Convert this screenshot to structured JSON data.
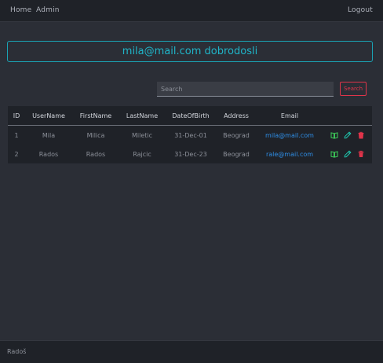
{
  "nav": {
    "home": "Home",
    "admin": "Admin",
    "logout": "Logout"
  },
  "welcome": "mila@mail.com dobrodosli",
  "search": {
    "placeholder": "Search",
    "button": "Search"
  },
  "table": {
    "headers": [
      "ID",
      "UserName",
      "FirstName",
      "LastName",
      "DateOfBirth",
      "Address",
      "Email"
    ],
    "rows": [
      {
        "id": "1",
        "username": "Mila",
        "firstname": "Milica",
        "lastname": "Miletic",
        "dob": "31-Dec-01",
        "address": "Beograd",
        "email": "mila@mail.com"
      },
      {
        "id": "2",
        "username": "Rados",
        "firstname": "Rados",
        "lastname": "Rajcic",
        "dob": "31-Dec-23",
        "address": "Beograd",
        "email": "rale@mail.com"
      }
    ],
    "row_icons": [
      "book-icon",
      "pencil-icon",
      "trash-icon"
    ]
  },
  "footer": "Radoš",
  "colors": {
    "accent": "#1fb5c9",
    "danger": "#e0344a",
    "link": "#2f8fe8",
    "view": "#3ecf5a",
    "edit": "#1fc9b0"
  }
}
